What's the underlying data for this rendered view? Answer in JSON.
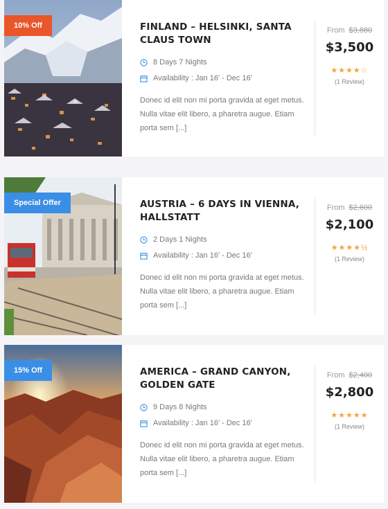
{
  "cards": [
    {
      "badge": "10% Off",
      "title": "FINLAND – HELSINKI, SANTA CLAUS TOWN",
      "duration": "8 Days 7 Nights",
      "availability": "Availability : Jan 16' - Dec 16'",
      "description": "Donec id elit non mi porta gravida at eget metus. Nulla vitae elit libero, a pharetra augue. Etiam porta sem [...]",
      "from_label": "From",
      "old_price": "$3,880",
      "price": "$3,500",
      "stars": "★★★★☆",
      "rating": 4,
      "reviews": "(1 Review)"
    },
    {
      "badge": "Special Offer",
      "title": "AUSTRIA – 6 DAYS IN VIENNA, HALLSTATT",
      "duration": "2 Days 1 Nights",
      "availability": "Availability : Jan 16' - Dec 16'",
      "description": "Donec id elit non mi porta gravida at eget metus. Nulla vitae elit libero, a pharetra augue. Etiam porta sem [...]",
      "from_label": "From",
      "old_price": "$2,600",
      "price": "$2,100",
      "stars": "★★★★½",
      "rating": 4.5,
      "reviews": "(1 Review)"
    },
    {
      "badge": "15% Off",
      "title": "AMERICA – GRAND CANYON, GOLDEN GATE",
      "duration": "9 Days 8 Nights",
      "availability": "Availability : Jan 16' - Dec 16'",
      "description": "Donec id elit non mi porta gravida at eget metus. Nulla vitae elit libero, a pharetra augue. Etiam porta sem [...]",
      "from_label": "From",
      "old_price": "$2,400",
      "price": "$2,800",
      "stars": "★★★★★",
      "rating": 5,
      "reviews": "(1 Review)"
    }
  ],
  "colors": {
    "badge_orange": "#e8562a",
    "badge_blue": "#3a8ee6",
    "star": "#f2a33c",
    "icon": "#3a8ee6"
  }
}
